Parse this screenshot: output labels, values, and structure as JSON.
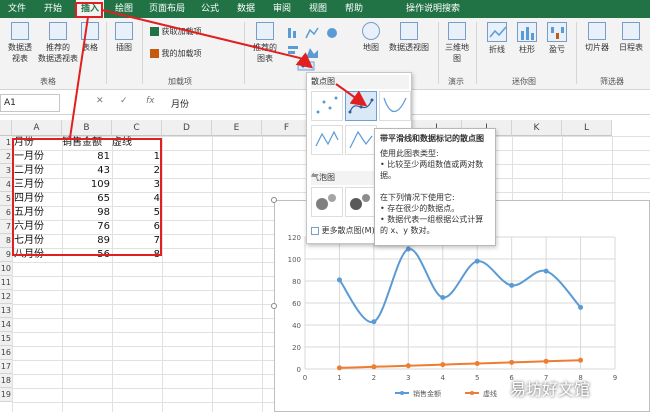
{
  "tabs": [
    "文件",
    "开始",
    "插入",
    "绘图",
    "页面布局",
    "公式",
    "数据",
    "审阅",
    "视图",
    "帮助",
    "操作说明搜索"
  ],
  "active_tab": "插入",
  "ribbon": {
    "pivot_recommend": "数据透\n视表",
    "pivot_recommended": "推荐的\n数据透视表",
    "table": "表格",
    "group_tables": "表格",
    "illustrations": "插图",
    "get_addins": "获取加载项",
    "my_addins": "我的加载项",
    "group_addins": "加载项",
    "recommended_charts": "推荐的\n图表",
    "map": "地图",
    "pivot_chart": "数据透视图",
    "map3d": "三维地\n图",
    "group_demo": "演示",
    "line": "折线",
    "column": "柱形",
    "winloss": "盈亏",
    "group_sparklines": "迷你图",
    "slicer": "切片器",
    "timeline": "日程表",
    "group_filters": "筛选器"
  },
  "formula_bar": {
    "name_box": "A1",
    "formula": "月份"
  },
  "columns": [
    "A",
    "B",
    "C",
    "D",
    "E",
    "F",
    "G",
    "H",
    "I",
    "J",
    "K",
    "L"
  ],
  "rows": [
    "1",
    "2",
    "3",
    "4",
    "5",
    "6",
    "7",
    "8",
    "9",
    "10",
    "11",
    "12",
    "13",
    "14",
    "15",
    "16",
    "17",
    "18",
    "19"
  ],
  "table": {
    "headers": [
      "月份",
      "销售金额",
      "虚线"
    ],
    "rows": [
      [
        "一月份",
        "81",
        "1"
      ],
      [
        "二月份",
        "43",
        "2"
      ],
      [
        "三月份",
        "109",
        "3"
      ],
      [
        "四月份",
        "65",
        "4"
      ],
      [
        "五月份",
        "98",
        "5"
      ],
      [
        "六月份",
        "76",
        "6"
      ],
      [
        "七月份",
        "89",
        "7"
      ],
      [
        "八月份",
        "56",
        "8"
      ]
    ]
  },
  "gallery": {
    "scatter_header": "散点图",
    "bubble_header": "气泡图",
    "more": "更多散点图(M)..."
  },
  "tooltip": {
    "title": "带平滑线和数据标记的散点图",
    "lines": [
      "使用此图表类型:",
      "• 比较至少两组数值或两对数",
      "据。",
      "",
      "在下列情况下使用它:",
      "• 存在很少的数据点。",
      "• 数据代表一组根据公式计算",
      "的 x、y 数对。"
    ]
  },
  "chart_data": {
    "type": "scatter",
    "x": [
      1,
      2,
      3,
      4,
      5,
      6,
      7,
      8
    ],
    "series": [
      {
        "name": "销售金额",
        "values": [
          81,
          43,
          109,
          65,
          98,
          76,
          89,
          56
        ],
        "color": "#5b9bd5",
        "smooth": true
      },
      {
        "name": "虚线",
        "values": [
          1,
          2,
          3,
          4,
          5,
          6,
          7,
          8
        ],
        "color": "#ed7d31",
        "smooth": true
      }
    ],
    "y_ticks": [
      "0",
      "20",
      "40",
      "60",
      "80",
      "100",
      "120"
    ],
    "x_ticks": [
      "0",
      "1",
      "2",
      "3",
      "4",
      "5",
      "6",
      "7",
      "8",
      "9"
    ],
    "xlim": [
      0,
      9
    ],
    "ylim": [
      0,
      120
    ],
    "grid": true,
    "legend": "bottom"
  },
  "watermark": "易坊好文馆"
}
